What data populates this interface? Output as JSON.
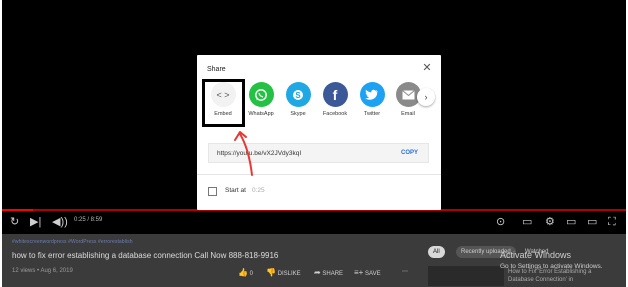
{
  "dialog": {
    "title": "Share",
    "share_targets": [
      {
        "label": "Embed",
        "icon": "code-icon",
        "color": "#f2f2f2"
      },
      {
        "label": "WhatsApp",
        "icon": "whatsapp-icon",
        "color": "#25c144"
      },
      {
        "label": "Skype",
        "icon": "skype-icon",
        "color": "#1fa8e3"
      },
      {
        "label": "Facebook",
        "icon": "facebook-icon",
        "color": "#3b5998"
      },
      {
        "label": "Twitter",
        "icon": "twitter-icon",
        "color": "#1da1f2"
      },
      {
        "label": "Email",
        "icon": "email-icon",
        "color": "#8a8a8a"
      }
    ],
    "link_url": "https://youtu.be/vX2JVdy3kqI",
    "copy_label": "COPY",
    "start_at_label": "Start at",
    "start_at_time": "0:25"
  },
  "player": {
    "time": "0:25 / 8:59",
    "progress": 0.05
  },
  "video": {
    "channel_line": "#whitescreenwordpress #WordPress #errorestablish",
    "title": "how to fix error establishing a database connection Call Now 888-818-9916",
    "meta": "12 views • Aug 6, 2019",
    "like_count": "0",
    "dislike_label": "DISLIKE",
    "share_label": "SHARE",
    "save_label": "SAVE"
  },
  "sidebar": {
    "chips": [
      "All",
      "Recently uploaded",
      "Watched"
    ],
    "item_title": "How to Fix 'Error Establishing a Database Connection' in"
  },
  "windows_watermark": {
    "title": "Activate Windows",
    "subtitle": "Go to Settings to activate Windows."
  },
  "colors": {
    "annotation": "#e53935",
    "highlight_box": "#000000",
    "copy_link": "#2a6ed0"
  }
}
